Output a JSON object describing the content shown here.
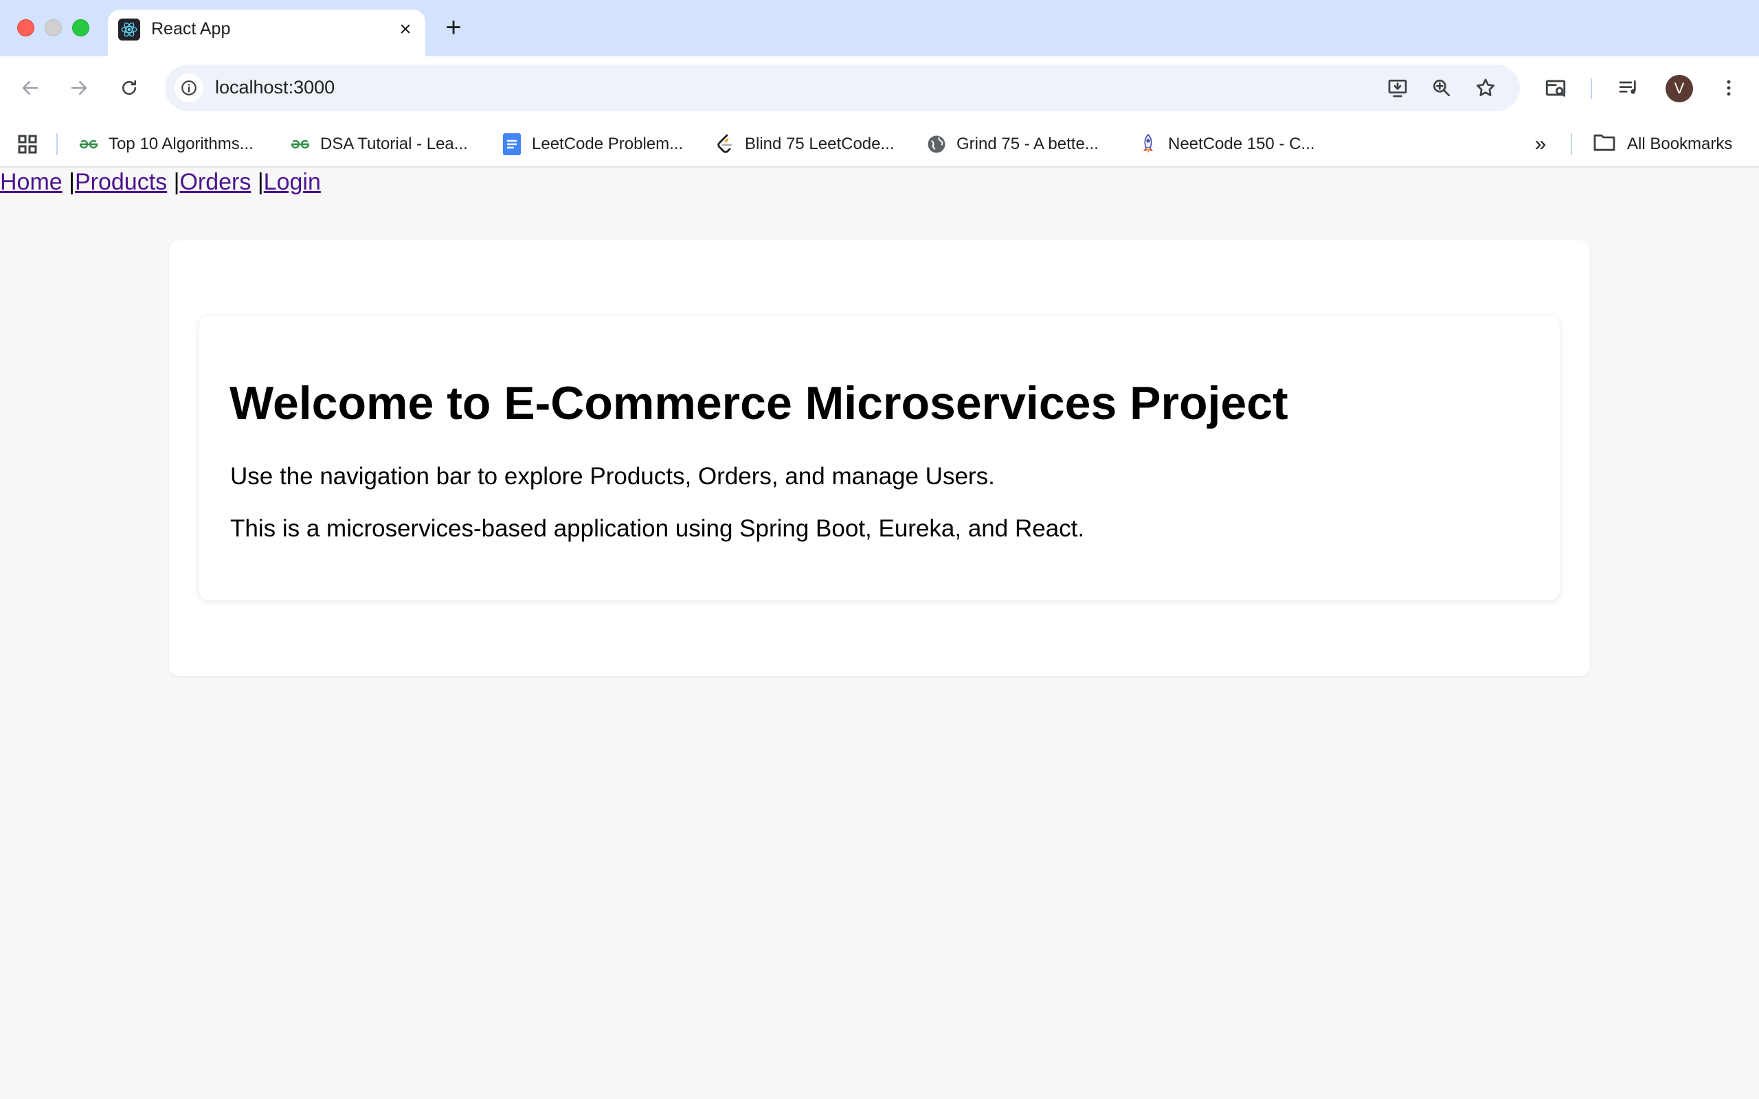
{
  "browser": {
    "tab": {
      "title": "React App",
      "favicon": "react-icon",
      "close": "×"
    },
    "new_tab": "+",
    "address": {
      "url": "localhost:3000"
    },
    "profile_initial": "V",
    "bookmarks": [
      {
        "label": "Top 10 Algorithms...",
        "icon": "geeksforgeeks-icon"
      },
      {
        "label": "DSA Tutorial - Lea...",
        "icon": "geeksforgeeks-icon"
      },
      {
        "label": "LeetCode Problem...",
        "icon": "google-docs-icon"
      },
      {
        "label": "Blind 75 LeetCode...",
        "icon": "leetcode-icon"
      },
      {
        "label": "Grind 75 - A bette...",
        "icon": "globe-icon"
      },
      {
        "label": "NeetCode 150 - C...",
        "icon": "rocket-icon"
      }
    ],
    "bookmarks_more": "»",
    "all_bookmarks": "All Bookmarks"
  },
  "site": {
    "nav": [
      {
        "label": "Home",
        "sep": " |"
      },
      {
        "label": "Products",
        "sep": " |"
      },
      {
        "label": "Orders",
        "sep": " |"
      },
      {
        "label": "Login",
        "sep": ""
      }
    ],
    "welcome": {
      "title": "Welcome to E-Commerce Microservices Project",
      "line1": "Use the navigation bar to explore Products, Orders, and manage Users.",
      "line2": "This is a microservices-based application using Spring Boot, Eureka, and React."
    }
  },
  "colors": {
    "tabstrip": "#d3e3fd",
    "link": "#4b148f",
    "page_bg": "#f8f8f8"
  }
}
